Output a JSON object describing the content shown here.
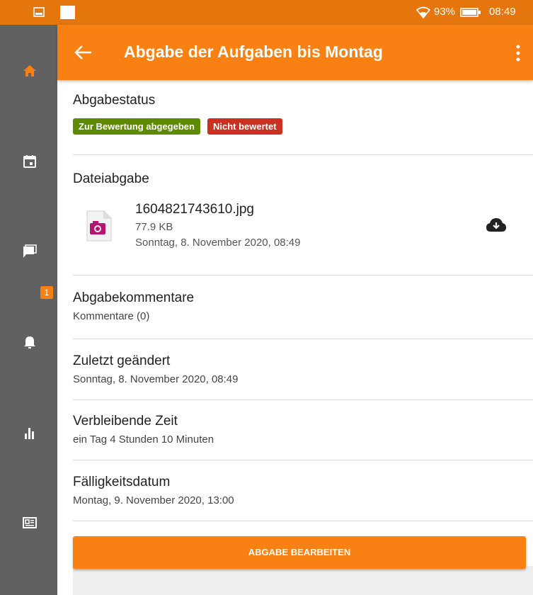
{
  "status_bar": {
    "battery_percent": "93%",
    "time": "08:49"
  },
  "rail": {
    "items": [
      "home-icon",
      "calendar-icon",
      "messages-icon",
      "notifications-icon",
      "grades-icon",
      "news-icon"
    ],
    "notification_count": "1"
  },
  "app_bar": {
    "title": "Abgabe der Aufgaben bis Montag"
  },
  "submission_status": {
    "heading": "Abgabestatus",
    "badge_submitted": "Zur Bewertung abgegeben",
    "badge_submitted_color": "#5e8a00",
    "badge_not_graded": "Nicht bewertet",
    "badge_not_graded_color": "#ca3120"
  },
  "file_submission": {
    "heading": "Dateiabgabe",
    "file_name": "1604821743610.jpg",
    "file_size": "77.9 KB",
    "file_date": "Sonntag, 8. November 2020, 08:49"
  },
  "comments": {
    "heading": "Abgabekommentare",
    "value": "Kommentare (0)"
  },
  "last_modified": {
    "heading": "Zuletzt geändert",
    "value": "Sonntag, 8. November 2020, 08:49"
  },
  "time_remaining": {
    "heading": "Verbleibende Zeit",
    "value": "ein Tag 4 Stunden 10 Minuten"
  },
  "due_date": {
    "heading": "Fälligkeitsdatum",
    "value": "Montag, 9. November 2020, 13:00"
  },
  "edit_button": {
    "label": "ABGABE BEARBEITEN"
  },
  "colors": {
    "brand_orange": "#f98012",
    "status_bar": "#e4760d",
    "rail": "#616161"
  }
}
